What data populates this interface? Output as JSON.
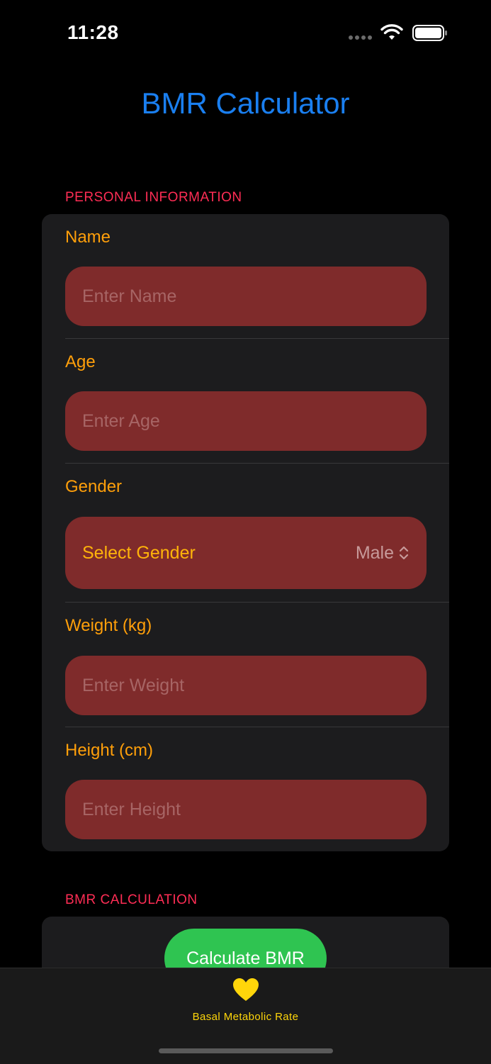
{
  "status_bar": {
    "time": "11:28"
  },
  "title": "BMR Calculator",
  "sections": {
    "personal_header": "PERSONAL INFORMATION",
    "calculation_header": "BMR CALCULATION"
  },
  "form": {
    "name": {
      "label": "Name",
      "placeholder": "Enter Name",
      "value": ""
    },
    "age": {
      "label": "Age",
      "placeholder": "Enter Age",
      "value": ""
    },
    "gender": {
      "label": "Gender",
      "picker_label": "Select Gender",
      "selected": "Male"
    },
    "weight": {
      "label": "Weight (kg)",
      "placeholder": "Enter Weight",
      "value": ""
    },
    "height": {
      "label": "Height (cm)",
      "placeholder": "Enter Height",
      "value": ""
    }
  },
  "calculate_button": "Calculate BMR",
  "tab_bar": {
    "items": [
      {
        "label": "Basal Metabolic Rate",
        "icon": "heart-icon"
      }
    ]
  },
  "colors": {
    "title": "#1a7ff0",
    "section_header": "#ff2d55",
    "field_label": "#ff9f0a",
    "field_background": "#7f2b2b",
    "button": "#2fc451",
    "tab_active": "#ffd60a"
  }
}
